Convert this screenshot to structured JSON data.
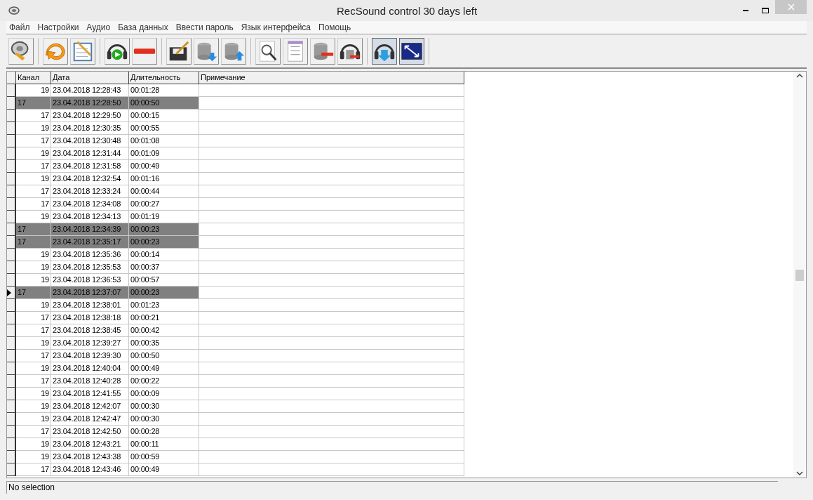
{
  "window": {
    "title": "RecSound control 30 days left"
  },
  "menu": [
    "Файл",
    "Настройки",
    "Аудио",
    "База данных",
    "Ввести пароль",
    "Язык интерфейса",
    "Помощь"
  ],
  "toolbar": [
    {
      "pressed": false
    },
    {
      "pressed": false
    },
    {
      "pressed": false
    },
    {
      "pressed": false
    },
    {
      "pressed": false
    },
    {
      "pressed": false
    },
    {
      "pressed": false
    },
    {
      "pressed": false
    },
    {
      "pressed": false
    },
    {
      "pressed": false
    },
    {
      "pressed": false
    },
    {
      "pressed": false
    },
    {
      "pressed": true
    },
    {
      "pressed": true
    }
  ],
  "table": {
    "columns": [
      "Канал",
      "Дата",
      "Длительность",
      "Примечание"
    ],
    "rows": [
      {
        "channel": "19",
        "date": "23.04.2018 12:28:43",
        "duration": "00:01:28",
        "selected": false,
        "current": false
      },
      {
        "channel": "17",
        "date": "23.04.2018 12:28:50",
        "duration": "00:00:50",
        "selected": true,
        "current": false
      },
      {
        "channel": "17",
        "date": "23.04.2018 12:29:50",
        "duration": "00:00:15",
        "selected": false,
        "current": false
      },
      {
        "channel": "19",
        "date": "23.04.2018 12:30:35",
        "duration": "00:00:55",
        "selected": false,
        "current": false
      },
      {
        "channel": "17",
        "date": "23.04.2018 12:30:48",
        "duration": "00:01:08",
        "selected": false,
        "current": false
      },
      {
        "channel": "19",
        "date": "23.04.2018 12:31:44",
        "duration": "00:01:09",
        "selected": false,
        "current": false
      },
      {
        "channel": "17",
        "date": "23.04.2018 12:31:58",
        "duration": "00:00:49",
        "selected": false,
        "current": false
      },
      {
        "channel": "19",
        "date": "23.04.2018 12:32:54",
        "duration": "00:01:16",
        "selected": false,
        "current": false
      },
      {
        "channel": "17",
        "date": "23.04.2018 12:33:24",
        "duration": "00:00:44",
        "selected": false,
        "current": false
      },
      {
        "channel": "17",
        "date": "23.04.2018 12:34:08",
        "duration": "00:00:27",
        "selected": false,
        "current": false
      },
      {
        "channel": "19",
        "date": "23.04.2018 12:34:13",
        "duration": "00:01:19",
        "selected": false,
        "current": false
      },
      {
        "channel": "17",
        "date": "23.04.2018 12:34:39",
        "duration": "00:00:23",
        "selected": true,
        "current": false
      },
      {
        "channel": "17",
        "date": "23.04.2018 12:35:17",
        "duration": "00:00:23",
        "selected": true,
        "current": false
      },
      {
        "channel": "19",
        "date": "23.04.2018 12:35:36",
        "duration": "00:00:14",
        "selected": false,
        "current": false
      },
      {
        "channel": "19",
        "date": "23.04.2018 12:35:53",
        "duration": "00:00:37",
        "selected": false,
        "current": false
      },
      {
        "channel": "19",
        "date": "23.04.2018 12:36:53",
        "duration": "00:00:57",
        "selected": false,
        "current": false
      },
      {
        "channel": "17",
        "date": "23.04.2018 12:37:07",
        "duration": "00:00:23",
        "selected": true,
        "current": true
      },
      {
        "channel": "19",
        "date": "23.04.2018 12:38:01",
        "duration": "00:01:23",
        "selected": false,
        "current": false
      },
      {
        "channel": "17",
        "date": "23.04.2018 12:38:18",
        "duration": "00:00:21",
        "selected": false,
        "current": false
      },
      {
        "channel": "17",
        "date": "23.04.2018 12:38:45",
        "duration": "00:00:42",
        "selected": false,
        "current": false
      },
      {
        "channel": "19",
        "date": "23.04.2018 12:39:27",
        "duration": "00:00:35",
        "selected": false,
        "current": false
      },
      {
        "channel": "17",
        "date": "23.04.2018 12:39:30",
        "duration": "00:00:50",
        "selected": false,
        "current": false
      },
      {
        "channel": "19",
        "date": "23.04.2018 12:40:04",
        "duration": "00:00:49",
        "selected": false,
        "current": false
      },
      {
        "channel": "17",
        "date": "23.04.2018 12:40:28",
        "duration": "00:00:22",
        "selected": false,
        "current": false
      },
      {
        "channel": "19",
        "date": "23.04.2018 12:41:55",
        "duration": "00:00:09",
        "selected": false,
        "current": false
      },
      {
        "channel": "19",
        "date": "23.04.2018 12:42:07",
        "duration": "00:00:30",
        "selected": false,
        "current": false
      },
      {
        "channel": "19",
        "date": "23.04.2018 12:42:47",
        "duration": "00:00:30",
        "selected": false,
        "current": false
      },
      {
        "channel": "17",
        "date": "23.04.2018 12:42:50",
        "duration": "00:00:28",
        "selected": false,
        "current": false
      },
      {
        "channel": "19",
        "date": "23.04.2018 12:43:21",
        "duration": "00:00:11",
        "selected": false,
        "current": false
      },
      {
        "channel": "19",
        "date": "23.04.2018 12:43:38",
        "duration": "00:00:59",
        "selected": false,
        "current": false
      },
      {
        "channel": "17",
        "date": "23.04.2018 12:43:46",
        "duration": "00:00:49",
        "selected": false,
        "current": false
      }
    ]
  },
  "status_bar": "No selection"
}
